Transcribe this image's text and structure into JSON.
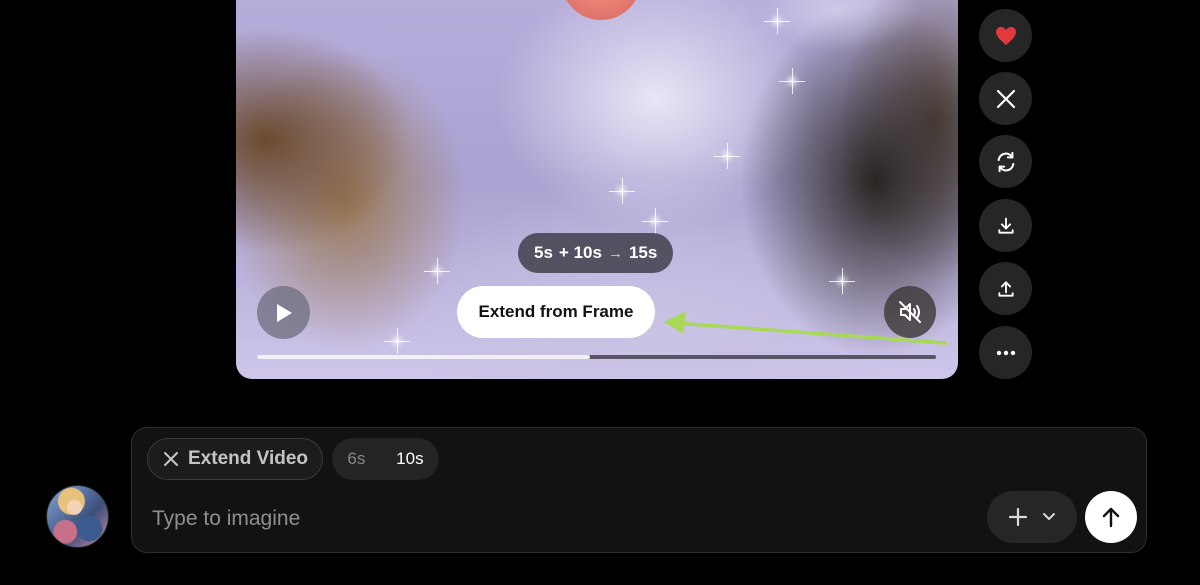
{
  "video": {
    "duration_pill": {
      "current": "5s",
      "added": "+ 10s",
      "arrow": "→",
      "total": "15s"
    },
    "extend_from_frame_label": "Extend from Frame",
    "progress_fraction": 0.49,
    "annotation_arrow_color": "#a7d957"
  },
  "side_actions": [
    {
      "name": "like-button",
      "icon": "heart-icon",
      "color": "#e0393e"
    },
    {
      "name": "share-x-button",
      "icon": "x-logo-icon"
    },
    {
      "name": "regenerate-button",
      "icon": "refresh-icon"
    },
    {
      "name": "download-button",
      "icon": "download-icon"
    },
    {
      "name": "upload-button",
      "icon": "upload-icon"
    },
    {
      "name": "more-button",
      "icon": "more-horizontal-icon"
    }
  ],
  "composer": {
    "mode_chip": "Extend Video",
    "durations": [
      "6s",
      "10s"
    ],
    "selected_duration": "10s",
    "placeholder": "Type to imagine",
    "options_icons": [
      "plus-icon",
      "chevron-down-icon"
    ],
    "send_icon": "arrow-up-icon"
  }
}
